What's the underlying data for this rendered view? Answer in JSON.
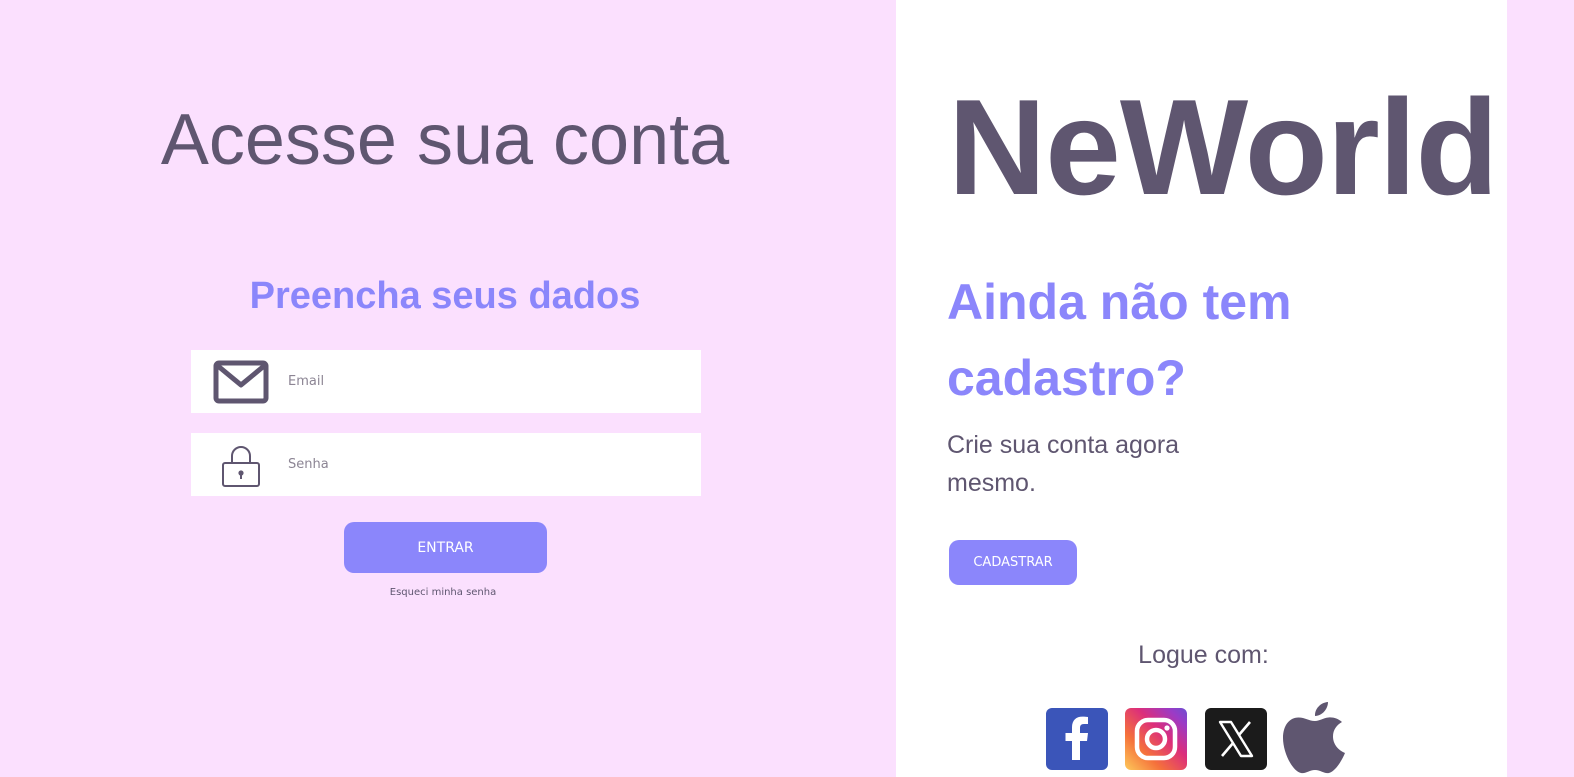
{
  "login": {
    "title": "Acesse sua conta",
    "subtitle": "Preencha seus dados",
    "email_placeholder": "Email",
    "password_placeholder": "Senha",
    "submit_label": "ENTRAR",
    "forgot_label": "Esqueci minha senha"
  },
  "register": {
    "brand": "NeWorld",
    "title": "Ainda não tem cadastro?",
    "text": "Crie sua conta agora mesmo.",
    "button_label": "CADASTRAR",
    "login_with_label": "Logue com:"
  },
  "social": [
    {
      "name": "facebook",
      "icon": "facebook-icon"
    },
    {
      "name": "instagram",
      "icon": "instagram-icon"
    },
    {
      "name": "x",
      "icon": "x-icon"
    },
    {
      "name": "apple",
      "icon": "apple-icon"
    }
  ],
  "colors": {
    "page_background": "#fbe0fe",
    "panel_background": "#ffffff",
    "accent": "#8b86fb",
    "text_dark": "#5f5670",
    "facebook": "#3b55b9",
    "x": "#1b1b1b"
  }
}
